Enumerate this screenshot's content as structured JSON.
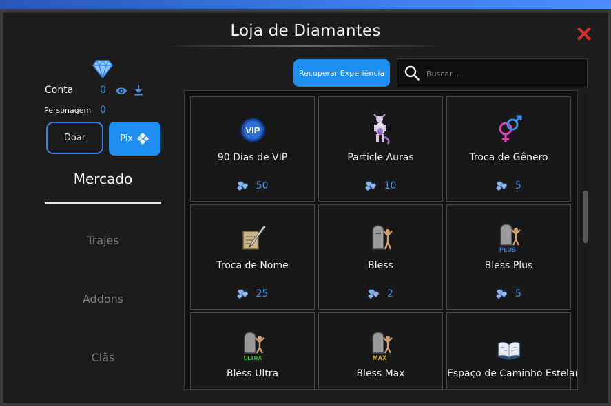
{
  "window": {
    "title": "Loja de Diamantes"
  },
  "balance": {
    "account_label": "Conta",
    "account_value": "0",
    "character_label": "Personagem",
    "character_value": "0"
  },
  "actions": {
    "donate_label": "Doar",
    "pix_label": "Pix"
  },
  "nav": {
    "active": "Mercado",
    "items": [
      "Trajes",
      "Addons",
      "Clãs"
    ]
  },
  "toolbar": {
    "recover_label": "Recuperar Experiência",
    "search_placeholder": "Buscar..."
  },
  "products": [
    {
      "name": "90 Dias de VIP",
      "price": "50",
      "icon": "vip-icon"
    },
    {
      "name": "Particle Auras",
      "price": "10",
      "icon": "mewtwo-icon"
    },
    {
      "name": "Troca de Gênero",
      "price": "5",
      "icon": "gender-icon"
    },
    {
      "name": "Troca de Nome",
      "price": "25",
      "icon": "scroll-quill-icon"
    },
    {
      "name": "Bless",
      "price": "2",
      "icon": "bless-icon"
    },
    {
      "name": "Bless Plus",
      "price": "5",
      "icon": "bless-plus-icon",
      "tag": "PLUS"
    },
    {
      "name": "Bless Ultra",
      "price": "",
      "icon": "bless-ultra-icon",
      "tag": "ULTRA"
    },
    {
      "name": "Bless Max",
      "price": "",
      "icon": "bless-max-icon",
      "tag": "MAX"
    },
    {
      "name": "Espaço de Caminho Estelar",
      "price": "",
      "icon": "book-icon"
    }
  ],
  "colors": {
    "accent_blue": "#1f8ef1",
    "price_blue": "#4a90e2",
    "close_red": "#d2322d",
    "window_bg": "#1c1c1c"
  }
}
